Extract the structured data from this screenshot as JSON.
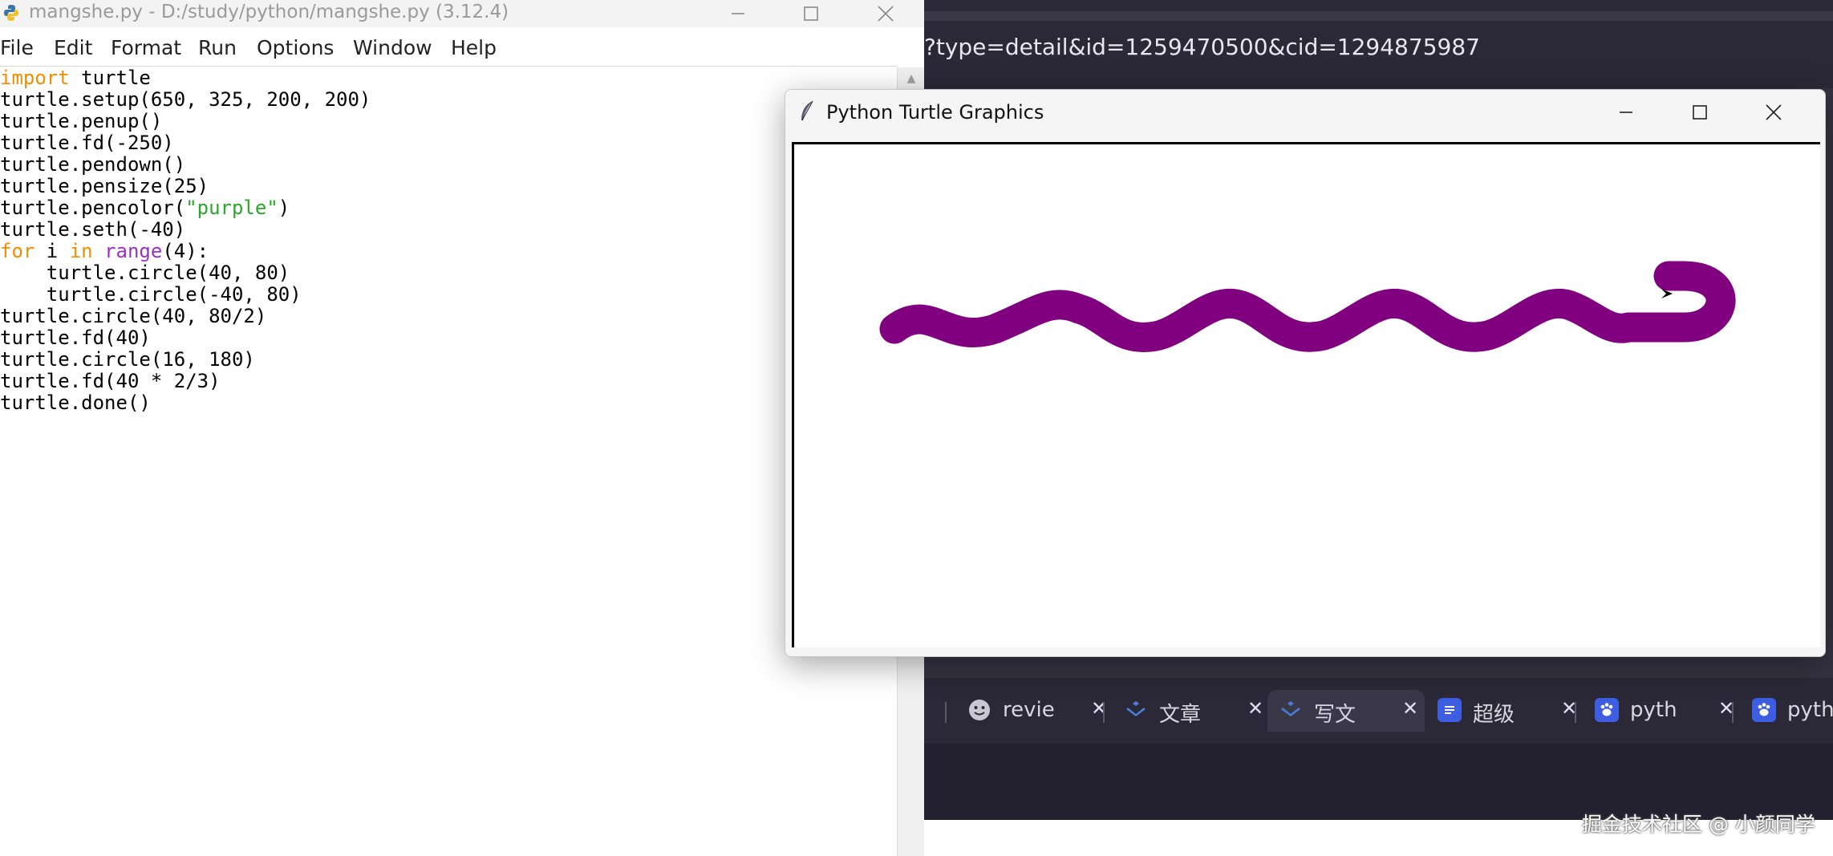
{
  "idle": {
    "title": "mangshe.py - D:/study/python/mangshe.py (3.12.4)",
    "menu": [
      "File",
      "Edit",
      "Format",
      "Run",
      "Options",
      "Window",
      "Help"
    ],
    "code": [
      {
        "tokens": [
          {
            "t": "import",
            "c": "kw"
          },
          {
            "t": " turtle",
            "c": ""
          }
        ]
      },
      {
        "tokens": [
          {
            "t": "turtle.setup(650, 325, 200, 200)",
            "c": ""
          }
        ]
      },
      {
        "tokens": [
          {
            "t": "turtle.penup()",
            "c": ""
          }
        ]
      },
      {
        "tokens": [
          {
            "t": "turtle.fd(-250)",
            "c": ""
          }
        ]
      },
      {
        "tokens": [
          {
            "t": "turtle.pendown()",
            "c": ""
          }
        ]
      },
      {
        "tokens": [
          {
            "t": "turtle.pensize(25)",
            "c": ""
          }
        ]
      },
      {
        "tokens": [
          {
            "t": "turtle.pencolor(",
            "c": ""
          },
          {
            "t": "\"purple\"",
            "c": "str"
          },
          {
            "t": ")",
            "c": ""
          }
        ]
      },
      {
        "tokens": [
          {
            "t": "turtle.seth(-40)",
            "c": ""
          }
        ]
      },
      {
        "tokens": [
          {
            "t": "for",
            "c": "kw"
          },
          {
            "t": " i ",
            "c": ""
          },
          {
            "t": "in",
            "c": "kw"
          },
          {
            "t": " ",
            "c": ""
          },
          {
            "t": "range",
            "c": "bi"
          },
          {
            "t": "(4):",
            "c": ""
          }
        ]
      },
      {
        "tokens": [
          {
            "t": "    turtle.circle(40, 80)",
            "c": ""
          }
        ]
      },
      {
        "tokens": [
          {
            "t": "    turtle.circle(-40, 80)",
            "c": ""
          }
        ]
      },
      {
        "tokens": [
          {
            "t": "turtle.circle(40, 80/2)",
            "c": ""
          }
        ]
      },
      {
        "tokens": [
          {
            "t": "turtle.fd(40)",
            "c": ""
          }
        ]
      },
      {
        "tokens": [
          {
            "t": "turtle.circle(16, 180)",
            "c": ""
          }
        ]
      },
      {
        "tokens": [
          {
            "t": "turtle.fd(40 * 2/3)",
            "c": ""
          }
        ]
      },
      {
        "tokens": [
          {
            "t": "turtle.done()",
            "c": ""
          }
        ]
      }
    ],
    "colors": {
      "keyword": "#f28c00",
      "builtin": "#9b30c8",
      "string": "#2aa82a"
    }
  },
  "browser": {
    "url_fragment": "?type=detail&id=1259470500&cid=1294875987",
    "tabs": [
      {
        "label": "revie",
        "icon": "smiley-icon",
        "active": false
      },
      {
        "label": "文章",
        "icon": "juejin-icon",
        "active": false
      },
      {
        "label": "写文",
        "icon": "juejin-icon",
        "active": true
      },
      {
        "label": "超级",
        "icon": "doc-icon",
        "active": false
      },
      {
        "label": "pyth",
        "icon": "baidu-paw-icon",
        "active": false
      },
      {
        "label": "pyth",
        "icon": "baidu-paw-icon",
        "active": false
      }
    ],
    "close_glyph": "✕",
    "watermark": "掘金技术社区 @ 小颜同学"
  },
  "turtle_window": {
    "title": "Python Turtle Graphics",
    "pen_color": "#800080"
  }
}
